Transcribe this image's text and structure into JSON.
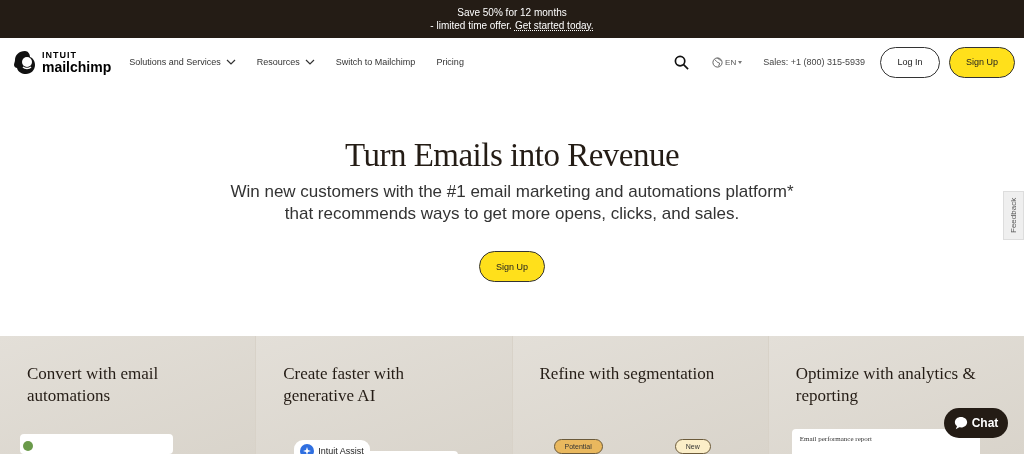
{
  "promo_banner": {
    "line_1": "Save 50% for 12 months",
    "line_2": "- limited time offer.",
    "link": "Get started today."
  },
  "nav": {
    "logo_top": "INTUIT",
    "logo_bottom": "mailchimp",
    "items": [
      {
        "label": "Solutions and Services",
        "has_menu": true
      },
      {
        "label": "Resources",
        "has_menu": true
      },
      {
        "label": "Switch to Mailchimp",
        "has_menu": false
      },
      {
        "label": "Pricing",
        "has_menu": false
      }
    ],
    "language": "EN",
    "sales": "Sales: +1 (800) 315-5939",
    "login": "Log In",
    "signup": "Sign Up"
  },
  "hero": {
    "title": "Turn Emails into Revenue",
    "subtitle_1": "Win new customers with the #1 email marketing and automations platform*",
    "subtitle_2": "that recommends ways to get more opens, clicks, and sales.",
    "cta": "Sign Up"
  },
  "features": [
    {
      "kind": "automation",
      "title": "Convert with email\nautomations"
    },
    {
      "kind": "assist",
      "title": "Create faster with\ngenerative AI",
      "chip": "Intuit Assist"
    },
    {
      "kind": "segments",
      "title": "Refine with segmentation",
      "tags": [
        "Potential",
        "New"
      ]
    },
    {
      "kind": "report",
      "title": "Optimize with analytics &\nreporting",
      "card": "Email performance report"
    }
  ],
  "feedback_tab": "Feedback",
  "chat_button": "Chat"
}
